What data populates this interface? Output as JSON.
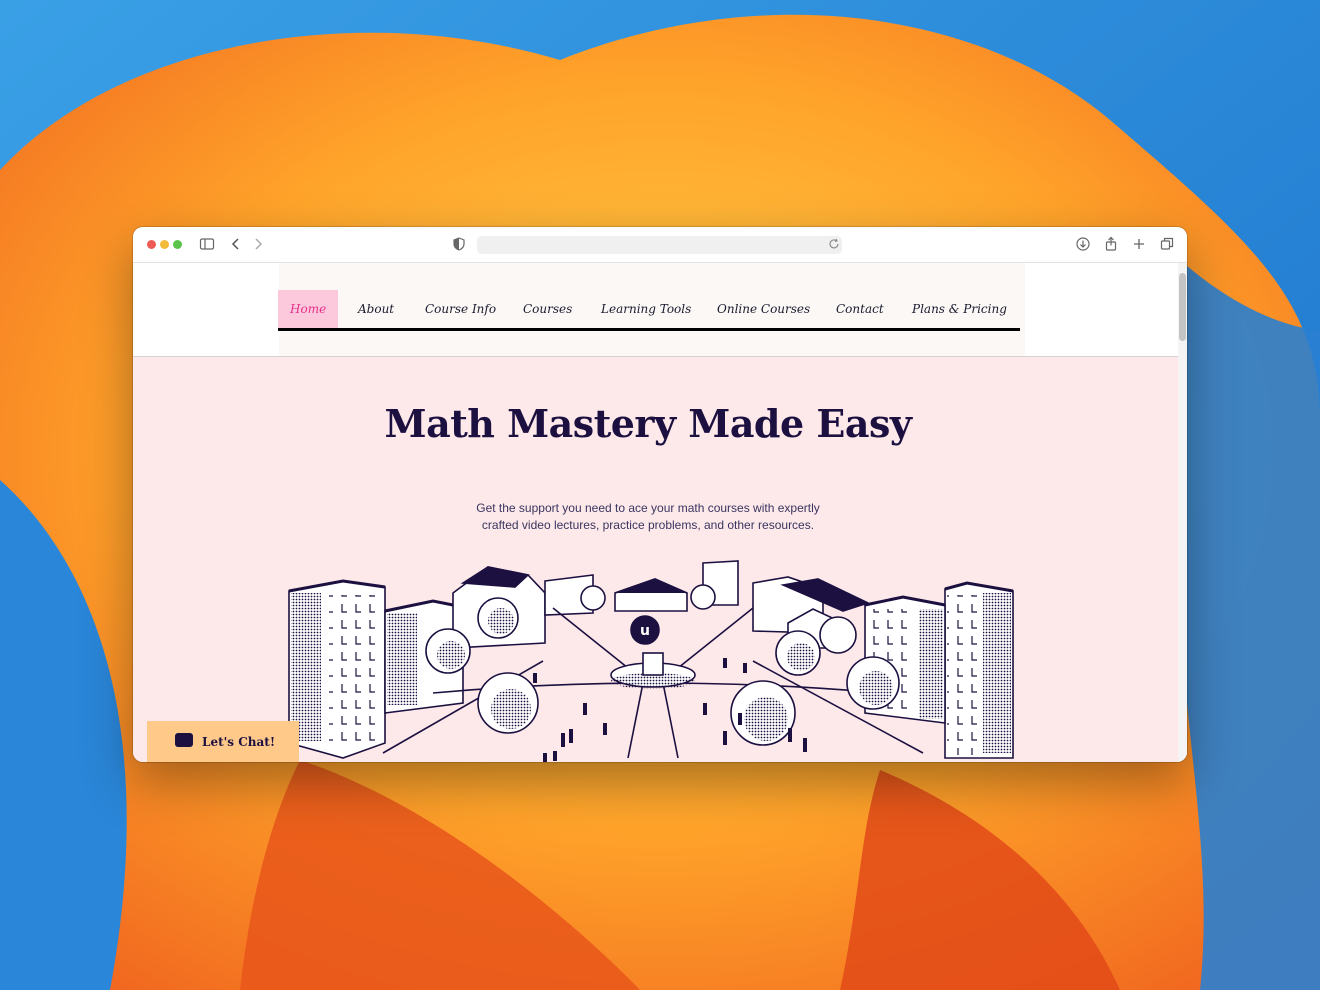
{
  "colors": {
    "accent_pink": "#e5308a",
    "active_bg": "#fcc9dc",
    "hero_bg": "#fde9ea",
    "title_navy": "#1c1040",
    "chat_bg": "#ffc98a"
  },
  "browser": {
    "icons": [
      "sidebar-icon",
      "back-icon",
      "forward-icon",
      "shield-icon",
      "reload-icon",
      "download-icon",
      "share-icon",
      "new-tab-icon",
      "tabs-icon"
    ]
  },
  "nav": {
    "items": [
      {
        "label": "Home",
        "active": true
      },
      {
        "label": "About"
      },
      {
        "label": "Course Info"
      },
      {
        "label": "Courses"
      },
      {
        "label": "Learning Tools"
      },
      {
        "label": "Online Courses"
      },
      {
        "label": "Contact"
      },
      {
        "label": "Plans & Pricing"
      }
    ]
  },
  "hero": {
    "title": "Math Mastery Made Easy",
    "subtitle": "Get the support you need to ace your math courses with expertly crafted video lectures, practice problems, and other resources.",
    "logo_letter": "u"
  },
  "chat": {
    "label": "Let's Chat!"
  }
}
